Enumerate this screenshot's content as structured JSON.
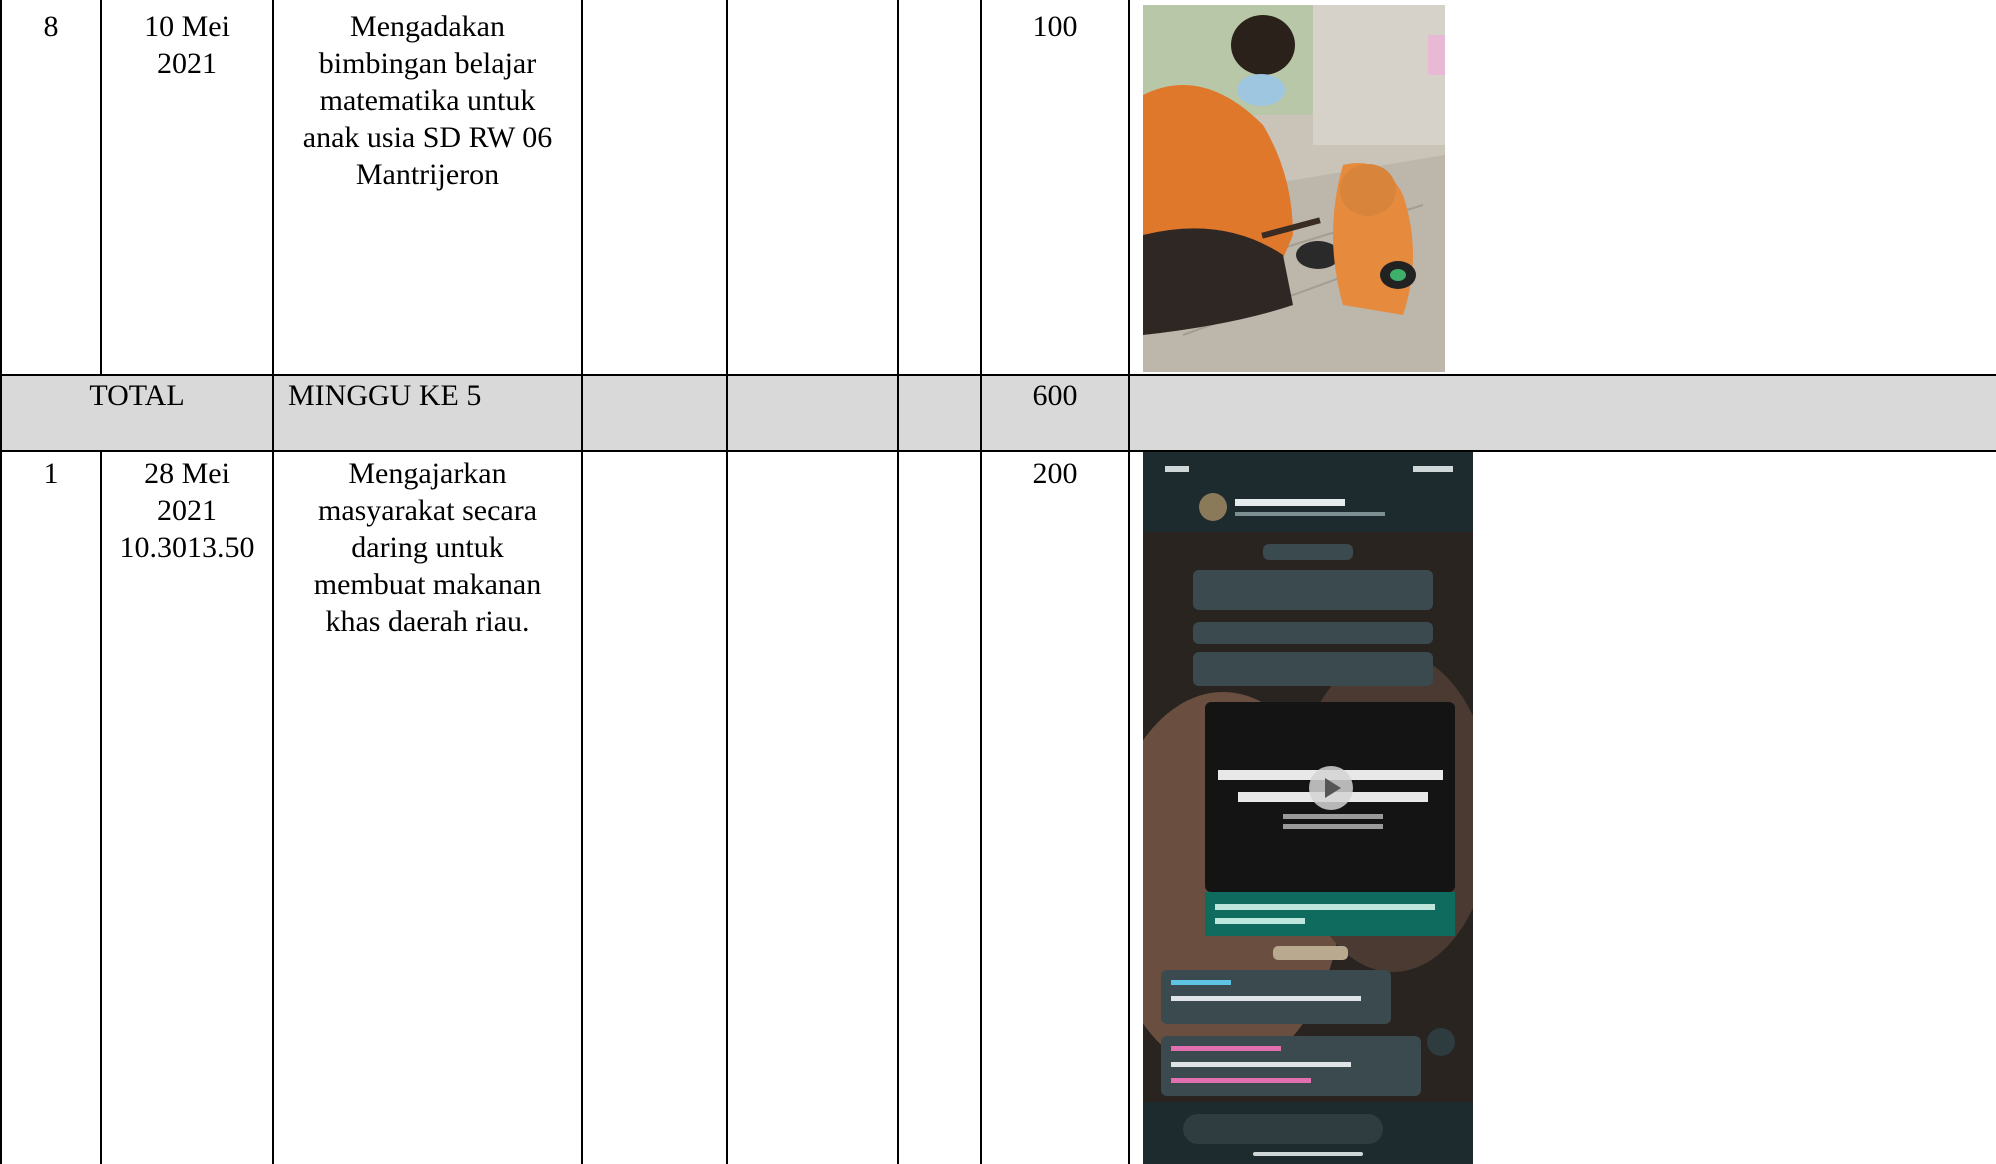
{
  "rows": [
    {
      "no": "8",
      "date": [
        "10 Mei",
        "2021"
      ],
      "activity": [
        "Mengadakan",
        "bimbingan belajar",
        "matematika untuk",
        "anak usia SD RW 06",
        "Mantrijeron"
      ],
      "minutes": "100",
      "photo_icon": "photo-tutoring"
    },
    {
      "no": "1",
      "date": [
        "28 Mei",
        "2021",
        "10.3013.50"
      ],
      "activity": [
        "Mengajarkan",
        "masyarakat secara",
        "daring untuk",
        "membuat makanan",
        "khas daerah riau."
      ],
      "minutes": "200",
      "photo_icon": "phone-screenshot-whatsapp"
    }
  ],
  "total_row": {
    "label": "TOTAL",
    "week": "MINGGU KE 5",
    "value": "600"
  },
  "colors": {
    "band": "#d9d9d9",
    "border": "#000000"
  }
}
